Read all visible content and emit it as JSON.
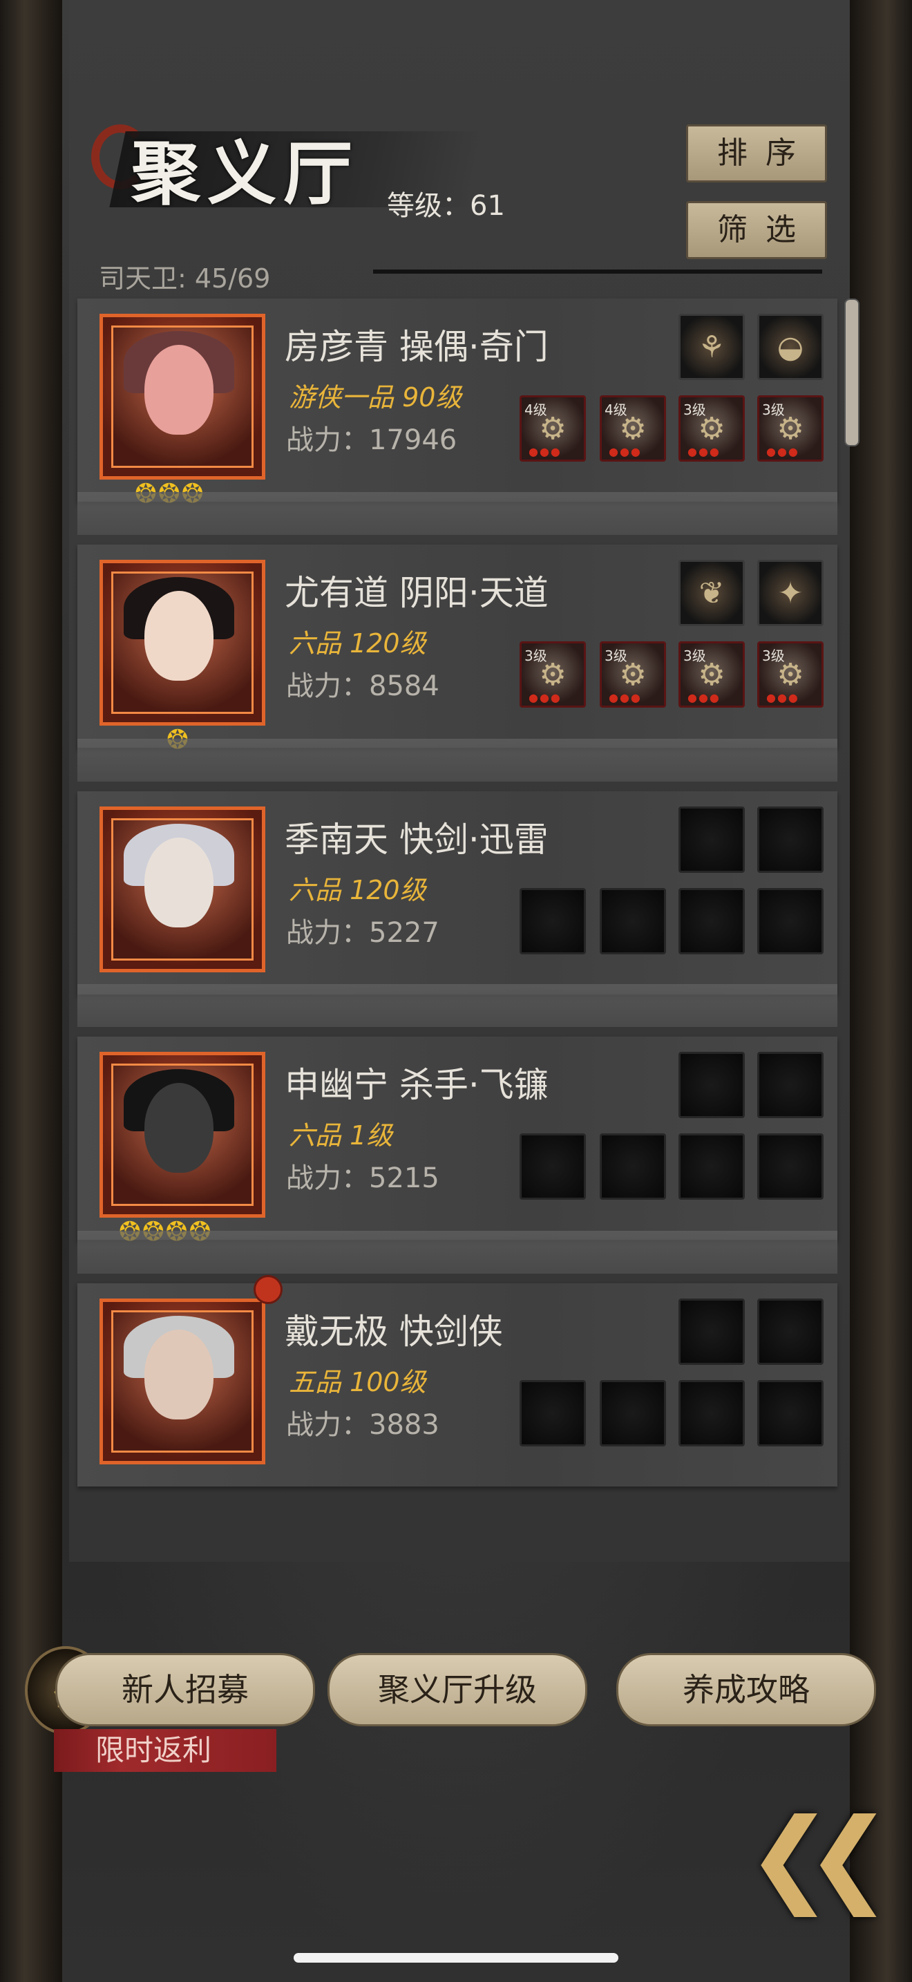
{
  "header": {
    "title": "聚义厅",
    "level": "等级：61",
    "guards": "司天卫: 45/69",
    "sort_label": "排序",
    "filter_label": "筛选"
  },
  "heroes": [
    {
      "name": "房彦青   操偶·奇门",
      "rank": "游侠一品 90级",
      "power": "战力：17946",
      "flames": 3,
      "weapon_slots": [
        "fan",
        "drum"
      ],
      "gear": [
        {
          "lvl": "4级"
        },
        {
          "lvl": "4级"
        },
        {
          "lvl": "3级"
        },
        {
          "lvl": "3级"
        }
      ]
    },
    {
      "name": "尤有道   阴阳·天道",
      "rank": "六品   120级",
      "power": "战力：8584",
      "flames": 1,
      "weapon_slots": [
        "feather",
        "staff"
      ],
      "gear": [
        {
          "lvl": "3级"
        },
        {
          "lvl": "3级"
        },
        {
          "lvl": "3级"
        },
        {
          "lvl": "3级"
        }
      ]
    },
    {
      "name": "季南天   快剑·迅雷",
      "rank": "六品   120级",
      "power": "战力：5227",
      "flames": 0,
      "weapon_slots": [
        "",
        ""
      ],
      "gear": [
        {
          "lvl": ""
        },
        {
          "lvl": ""
        },
        {
          "lvl": ""
        },
        {
          "lvl": ""
        }
      ]
    },
    {
      "name": "申幽宁   杀手·飞镰",
      "rank": "六品   1级",
      "power": "战力：5215",
      "flames": 4,
      "weapon_slots": [
        "",
        ""
      ],
      "gear": [
        {
          "lvl": ""
        },
        {
          "lvl": ""
        },
        {
          "lvl": ""
        },
        {
          "lvl": ""
        }
      ]
    },
    {
      "name": "戴无极   快剑侠",
      "rank": "五品   100级",
      "power": "战力：3883",
      "flames": 0,
      "weapon_slots": [
        "",
        ""
      ],
      "gear": [
        {
          "lvl": ""
        },
        {
          "lvl": ""
        },
        {
          "lvl": ""
        },
        {
          "lvl": ""
        }
      ]
    }
  ],
  "bottom": {
    "recruit_label": "新人招募",
    "upgrade_label": "聚义厅升级",
    "guide_label": "养成攻略",
    "promo_label": "限时返利",
    "token_glyph": "侠",
    "back_icon": "double-chevron-left-icon"
  },
  "colors": {
    "portrait_border": "#e0642a",
    "rank_gold": "#e9b53a",
    "button_tan": "#c8b99b",
    "promo_red": "#a02a2c"
  }
}
